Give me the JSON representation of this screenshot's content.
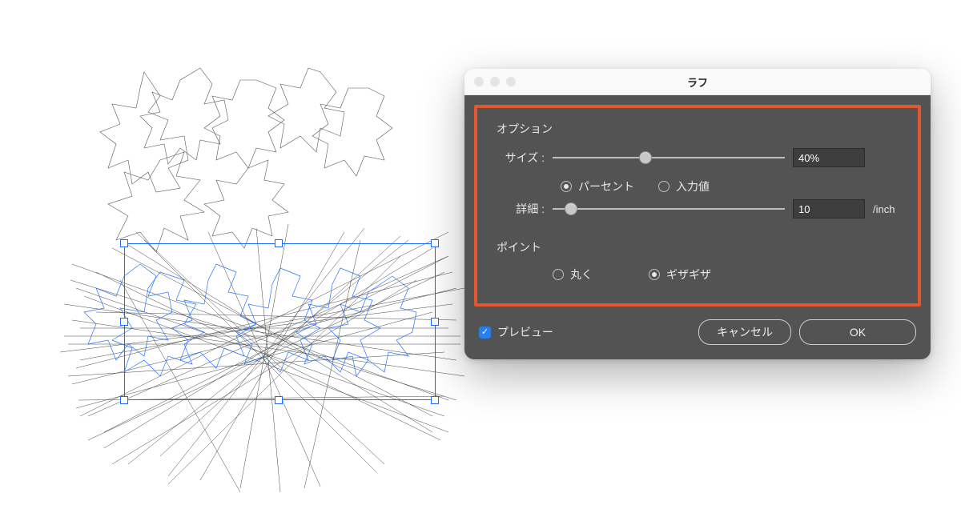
{
  "dialog": {
    "title": "ラフ",
    "options": {
      "label": "オプション",
      "size": {
        "label": "サイズ :",
        "value": "40%",
        "slider_percent": 40,
        "unit_percent": "パーセント",
        "unit_absolute": "入力値",
        "selected_unit": "percent"
      },
      "detail": {
        "label": "詳細 :",
        "value": "10",
        "slider_percent": 8,
        "unit": "/inch"
      }
    },
    "points": {
      "label": "ポイント",
      "smooth": "丸く",
      "corner": "ギザギザ",
      "selected": "corner"
    },
    "footer": {
      "preview": "プレビュー",
      "preview_checked": true,
      "cancel": "キャンセル",
      "ok": "OK"
    }
  },
  "colors": {
    "highlight": "#e4572e",
    "panel": "#535353",
    "selection": "#1a6cff"
  }
}
